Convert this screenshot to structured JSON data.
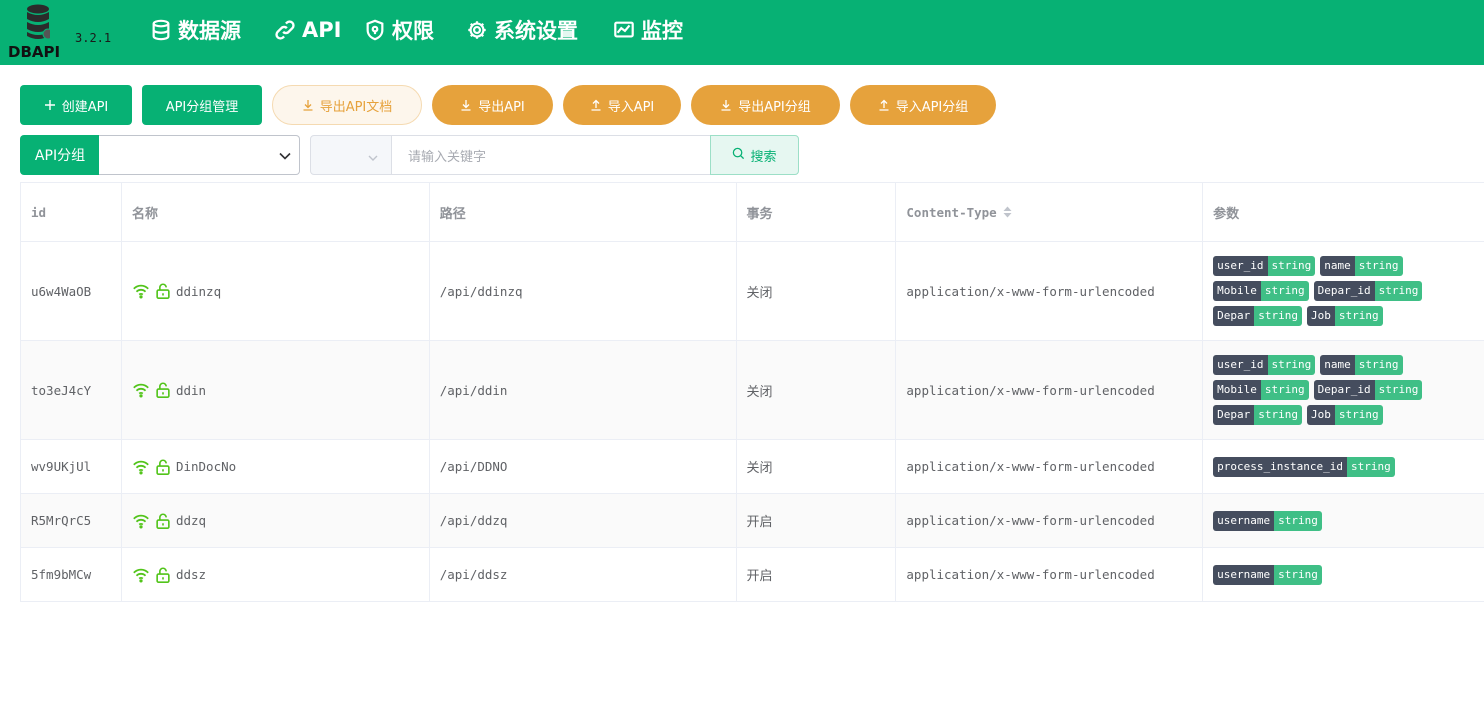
{
  "app": {
    "logo_text": "DBAPI",
    "version": "3.2.1"
  },
  "nav": [
    {
      "label": "数据源",
      "icon": "database-icon"
    },
    {
      "label": "API",
      "icon": "link-icon"
    },
    {
      "label": "权限",
      "icon": "shield-icon"
    },
    {
      "label": "系统设置",
      "icon": "gear-icon"
    },
    {
      "label": "监控",
      "icon": "monitor-chart-icon"
    }
  ],
  "toolbar": {
    "create_api": "创建API",
    "group_manage": "API分组管理",
    "export_doc": "导出API文档",
    "export_api": "导出API",
    "import_api": "导入API",
    "export_group": "导出API分组",
    "import_group": "导入API分组"
  },
  "filter": {
    "group_label": "API分组",
    "group_value": "",
    "keyword_field": "",
    "keyword_placeholder": "请输入关键字",
    "search_label": "搜索"
  },
  "table": {
    "headers": {
      "id": "id",
      "name": "名称",
      "path": "路径",
      "transaction": "事务",
      "content_type": "Content-Type",
      "params": "参数"
    },
    "rows": [
      {
        "id": "u6w4WaOB",
        "name": "ddinzq",
        "path": "/api/ddinzq",
        "transaction": "关闭",
        "content_type": "application/x-www-form-urlencoded",
        "params": [
          {
            "k": "user_id",
            "t": "string"
          },
          {
            "k": "name",
            "t": "string"
          },
          {
            "k": "Mobile",
            "t": "string"
          },
          {
            "k": "Depar_id",
            "t": "string"
          },
          {
            "k": "Depar",
            "t": "string"
          },
          {
            "k": "Job",
            "t": "string"
          }
        ]
      },
      {
        "id": "to3eJ4cY",
        "name": "ddin",
        "path": "/api/ddin",
        "transaction": "关闭",
        "content_type": "application/x-www-form-urlencoded",
        "params": [
          {
            "k": "user_id",
            "t": "string"
          },
          {
            "k": "name",
            "t": "string"
          },
          {
            "k": "Mobile",
            "t": "string"
          },
          {
            "k": "Depar_id",
            "t": "string"
          },
          {
            "k": "Depar",
            "t": "string"
          },
          {
            "k": "Job",
            "t": "string"
          }
        ]
      },
      {
        "id": "wv9UKjUl",
        "name": "DinDocNo",
        "path": "/api/DDNO",
        "transaction": "关闭",
        "content_type": "application/x-www-form-urlencoded",
        "params": [
          {
            "k": "process_instance_id",
            "t": "string"
          }
        ]
      },
      {
        "id": "R5MrQrC5",
        "name": "ddzq",
        "path": "/api/ddzq",
        "transaction": "开启",
        "content_type": "application/x-www-form-urlencoded",
        "params": [
          {
            "k": "username",
            "t": "string"
          }
        ]
      },
      {
        "id": "5fm9bMCw",
        "name": "ddsz",
        "path": "/api/ddsz",
        "transaction": "开启",
        "content_type": "application/x-www-form-urlencoded",
        "params": [
          {
            "k": "username",
            "t": "string"
          }
        ]
      }
    ]
  },
  "colors": {
    "primary": "#07b174",
    "warning": "#e6a23c",
    "tag_key": "#454d5e",
    "tag_type": "#3fbf86"
  }
}
